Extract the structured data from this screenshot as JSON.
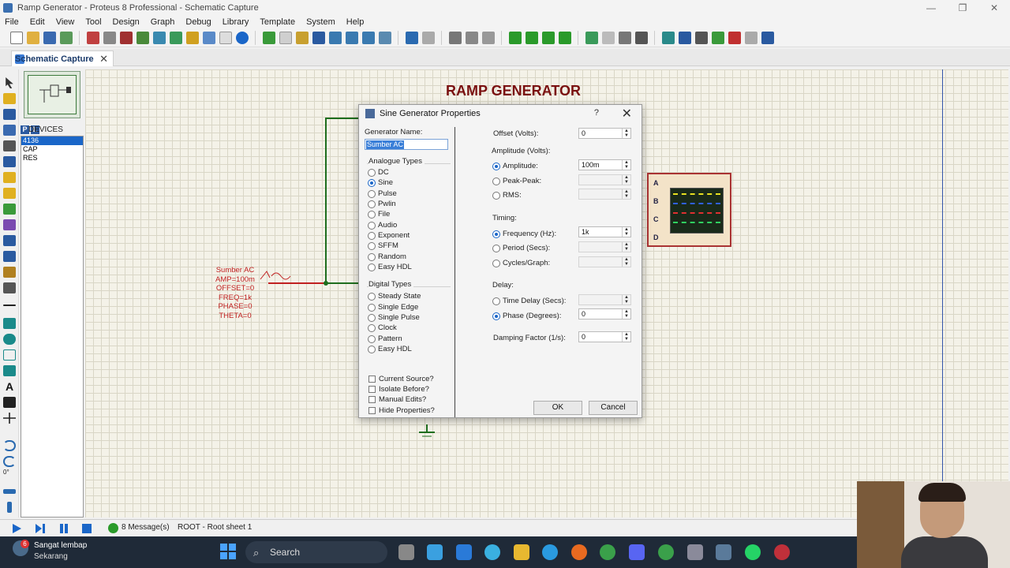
{
  "window": {
    "title": "Ramp Generator - Proteus 8 Professional - Schematic Capture"
  },
  "menu": [
    "File",
    "Edit",
    "View",
    "Tool",
    "Design",
    "Graph",
    "Debug",
    "Library",
    "Template",
    "System",
    "Help"
  ],
  "tab": {
    "label": "Schematic Capture"
  },
  "devices": {
    "header_p": "P",
    "header_l": "L",
    "header": "DEVICES",
    "items": [
      "4136",
      "CAP",
      "RES"
    ],
    "selected": "4136"
  },
  "left_tools": {
    "rotation": "0°"
  },
  "schematic": {
    "title": "RAMP GENERATOR",
    "source_label": [
      "Sumber AC",
      "AMP=100m",
      "OFFSET=0",
      "FREQ=1k",
      "PHASE=0",
      "THETA=0"
    ],
    "scope_channels": [
      "A",
      "B",
      "C",
      "D"
    ]
  },
  "dialog": {
    "title": "Sine Generator Properties",
    "help": "?",
    "generator_name_label": "Generator Name:",
    "generator_name_value": "Sumber AC",
    "analogue_label": "Analogue Types",
    "analogue_types": [
      "DC",
      "Sine",
      "Pulse",
      "Pwlin",
      "File",
      "Audio",
      "Exponent",
      "SFFM",
      "Random",
      "Easy HDL"
    ],
    "analogue_selected": "Sine",
    "digital_label": "Digital Types",
    "digital_types": [
      "Steady State",
      "Single Edge",
      "Single Pulse",
      "Clock",
      "Pattern",
      "Easy HDL"
    ],
    "checkboxes": [
      "Current Source?",
      "Isolate Before?",
      "Manual Edits?",
      "Hide Properties?"
    ],
    "offset_label": "Offset (Volts):",
    "offset_value": "0",
    "amplitude_group": "Amplitude (Volts):",
    "amplitude_options": [
      "Amplitude:",
      "Peak-Peak:",
      "RMS:"
    ],
    "amplitude_value": "100m",
    "timing_group": "Timing:",
    "timing_options": [
      "Frequency (Hz):",
      "Period (Secs):",
      "Cycles/Graph:"
    ],
    "frequency_value": "1k",
    "delay_group": "Delay:",
    "delay_options": [
      "Time Delay (Secs):",
      "Phase (Degrees):"
    ],
    "phase_value": "0",
    "damping_label": "Damping Factor (1/s):",
    "damping_value": "0",
    "ok": "OK",
    "cancel": "Cancel"
  },
  "status": {
    "messages": "8 Message(s)",
    "sheet": "ROOT - Root sheet 1"
  },
  "taskbar": {
    "weather_badge": "6",
    "weather_line1": "Sangat lembap",
    "weather_line2": "Sekarang",
    "search": "Search"
  },
  "colors": {
    "accent": "#1a66c8",
    "wire_green": "#1e6e1e",
    "wire_red": "#c02020",
    "title_red": "#7a1010"
  }
}
